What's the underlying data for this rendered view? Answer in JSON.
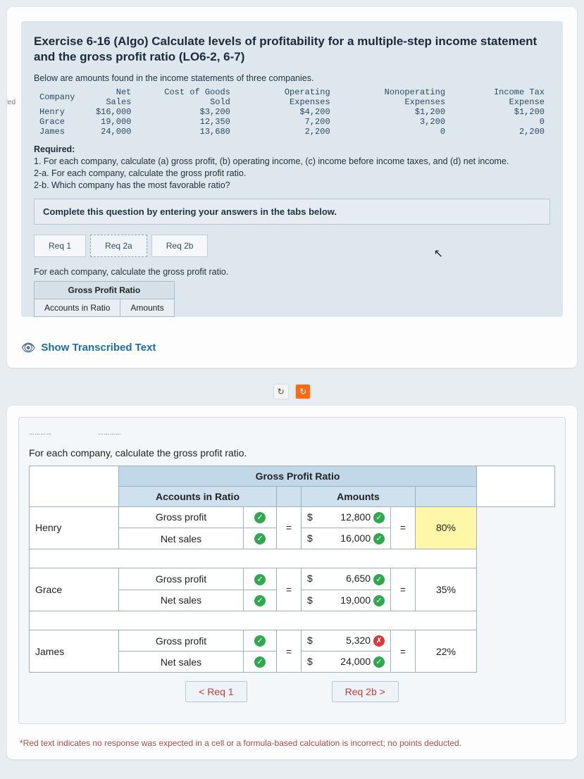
{
  "exercise": {
    "title": "Exercise 6-16 (Algo) Calculate levels of profitability for a multiple-step income statement and the gross profit ratio (LO6-2, 6-7)",
    "intro": "Below are amounts found in the income statements of three companies.",
    "side_tag": "rded",
    "table": {
      "headers": [
        "Company",
        "Net Sales",
        "Cost of Goods Sold",
        "Operating Expenses",
        "Nonoperating Expenses",
        "Income Tax Expense"
      ],
      "rows": [
        {
          "c": "Henry",
          "ns": "$16,000",
          "cogs": "$3,200",
          "op": "$4,200",
          "nop": "$1,200",
          "tax": "$1,200"
        },
        {
          "c": "Grace",
          "ns": "19,000",
          "cogs": "12,350",
          "op": "7,200",
          "nop": "3,200",
          "tax": "0"
        },
        {
          "c": "James",
          "ns": "24,000",
          "cogs": "13,680",
          "op": "2,200",
          "nop": "0",
          "tax": "2,200"
        }
      ]
    },
    "required_label": "Required:",
    "required": "1. For each company, calculate (a) gross profit, (b) operating income, (c) income before income taxes, and (d) net income.\n2-a. For each company, calculate the gross profit ratio.\n2-b. Which company has the most favorable ratio?",
    "boxed": "Complete this question by entering your answers in the tabs below.",
    "tabs": [
      "Req 1",
      "Req 2a",
      "Req 2b"
    ],
    "tab_instr": "For each company, calculate the gross profit ratio.",
    "mini_table": {
      "group": "Gross Profit Ratio",
      "h1": "Accounts in Ratio",
      "h2": "Amounts"
    },
    "cursor": "↖"
  },
  "transcribed": {
    "label": "Show Transcribed Text"
  },
  "icons": {
    "rotate": "↻",
    "refresh": "↻"
  },
  "answer": {
    "instr": "For each company, calculate the gross profit ratio.",
    "group": "Gross Profit Ratio",
    "col_accounts": "Accounts in Ratio",
    "col_amounts": "Amounts",
    "rows": [
      {
        "company": "Henry",
        "num_label": "Gross profit",
        "den_label": "Net sales",
        "num_ok": true,
        "den_ok": true,
        "num_amt": "12,800",
        "den_amt": "16,000",
        "num_amt_ok": true,
        "den_amt_ok": true,
        "pct": "80%",
        "pct_hl": true
      },
      {
        "company": "Grace",
        "num_label": "Gross profit",
        "den_label": "Net sales",
        "num_ok": true,
        "den_ok": true,
        "num_amt": "6,650",
        "den_amt": "19,000",
        "num_amt_ok": true,
        "den_amt_ok": true,
        "pct": "35%",
        "pct_hl": false
      },
      {
        "company": "James",
        "num_label": "Gross profit",
        "den_label": "Net sales",
        "num_ok": true,
        "den_ok": true,
        "num_amt": "5,320",
        "den_amt": "24,000",
        "num_amt_ok": false,
        "den_amt_ok": true,
        "pct": "22%",
        "pct_hl": false
      }
    ],
    "nav_prev": "<  Req 1",
    "nav_next": "Req 2b  >",
    "footnote": "*Red text indicates no response was expected in a cell or a formula-based calculation is incorrect; no points deducted."
  }
}
